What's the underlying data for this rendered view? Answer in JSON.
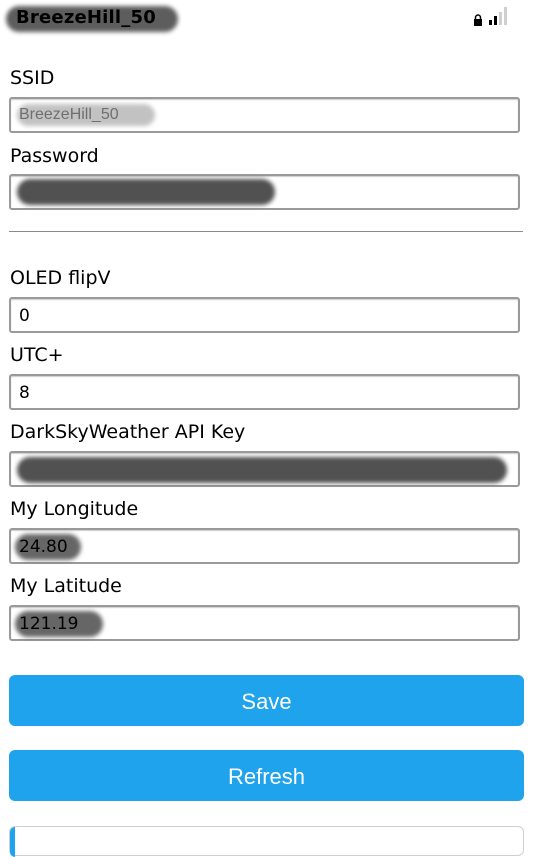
{
  "header": {
    "network_name": "BreezeHill_50",
    "icons": [
      "lock-icon",
      "wifi-signal-icon"
    ]
  },
  "form": {
    "ssid_label": "SSID",
    "ssid_value": "BreezeHill_50",
    "password_label": "Password",
    "password_value": "",
    "oled_label": "OLED flipV",
    "oled_value": "0",
    "utc_label": "UTC+",
    "utc_value": "8",
    "api_label": "DarkSkyWeather API Key",
    "api_value": "",
    "longitude_label": "My Longitude",
    "longitude_value": "24.80",
    "latitude_label": "My Latitude",
    "latitude_value": "121.19"
  },
  "buttons": {
    "save_label": "Save",
    "refresh_label": "Refresh"
  },
  "colors": {
    "button_bg": "#1fa3ec",
    "button_text": "#ffffff",
    "field_border": "#9a9a9a"
  }
}
